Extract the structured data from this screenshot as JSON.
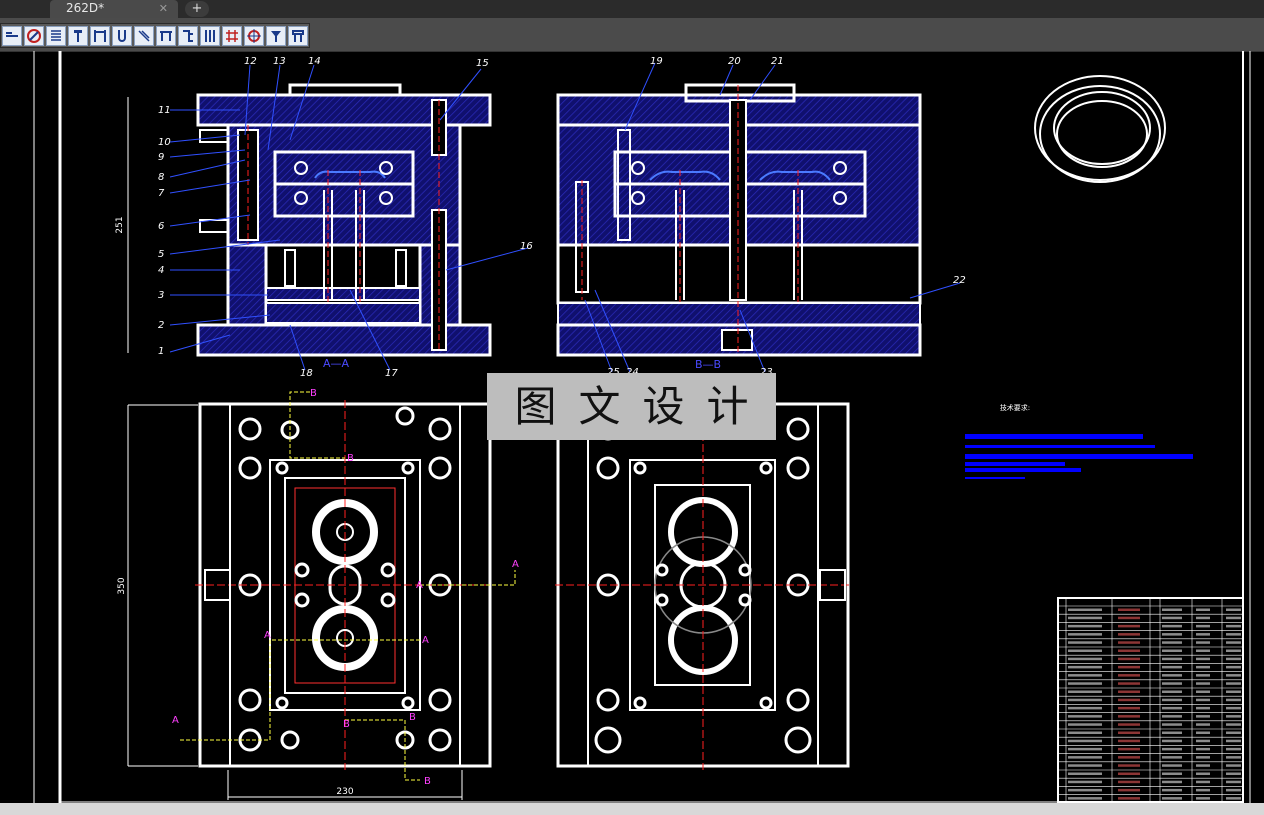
{
  "tab": {
    "title": "262D*",
    "close_glyph": "✕",
    "new_tab_glyph": "+"
  },
  "toolbar": {
    "buttons": [
      "line-tool",
      "circle-hatch-tool",
      "spring-tool",
      "bolt-tool",
      "bracket-tool",
      "hook-tool",
      "slash-tool",
      "beam-tool",
      "angle-tool",
      "column-tool",
      "grid-tool",
      "target-tool",
      "screw-tool",
      "clamp-tool"
    ]
  },
  "drawing": {
    "section_aa": "A—A",
    "section_bb": "B—B",
    "dim_height_top": "251",
    "dim_height_bottom": "350",
    "dim_width_bottom": "230",
    "callouts_left": [
      "11",
      "10",
      "9",
      "8",
      "7",
      "6",
      "5",
      "4",
      "3",
      "2",
      "1"
    ],
    "callouts_top": [
      "12",
      "13",
      "14",
      "15"
    ],
    "callouts_right": [
      "16",
      "17",
      "18"
    ],
    "callouts_bb": [
      "19",
      "20",
      "21",
      "22",
      "23",
      "24",
      "25"
    ],
    "marker_a": "A",
    "marker_b": "B",
    "tech_requirements_title": "技术要求:",
    "watermark_text": "图文设计"
  },
  "colors": {
    "drawing_white": "#ffffff",
    "hatch_blue": "#1a1a9a",
    "section_blue": "#0000ff",
    "centerline_red": "#ff2020",
    "marker_magenta": "#ff40ff",
    "leader_blue": "#3050ff",
    "dim_yellow": "#ffff40"
  }
}
